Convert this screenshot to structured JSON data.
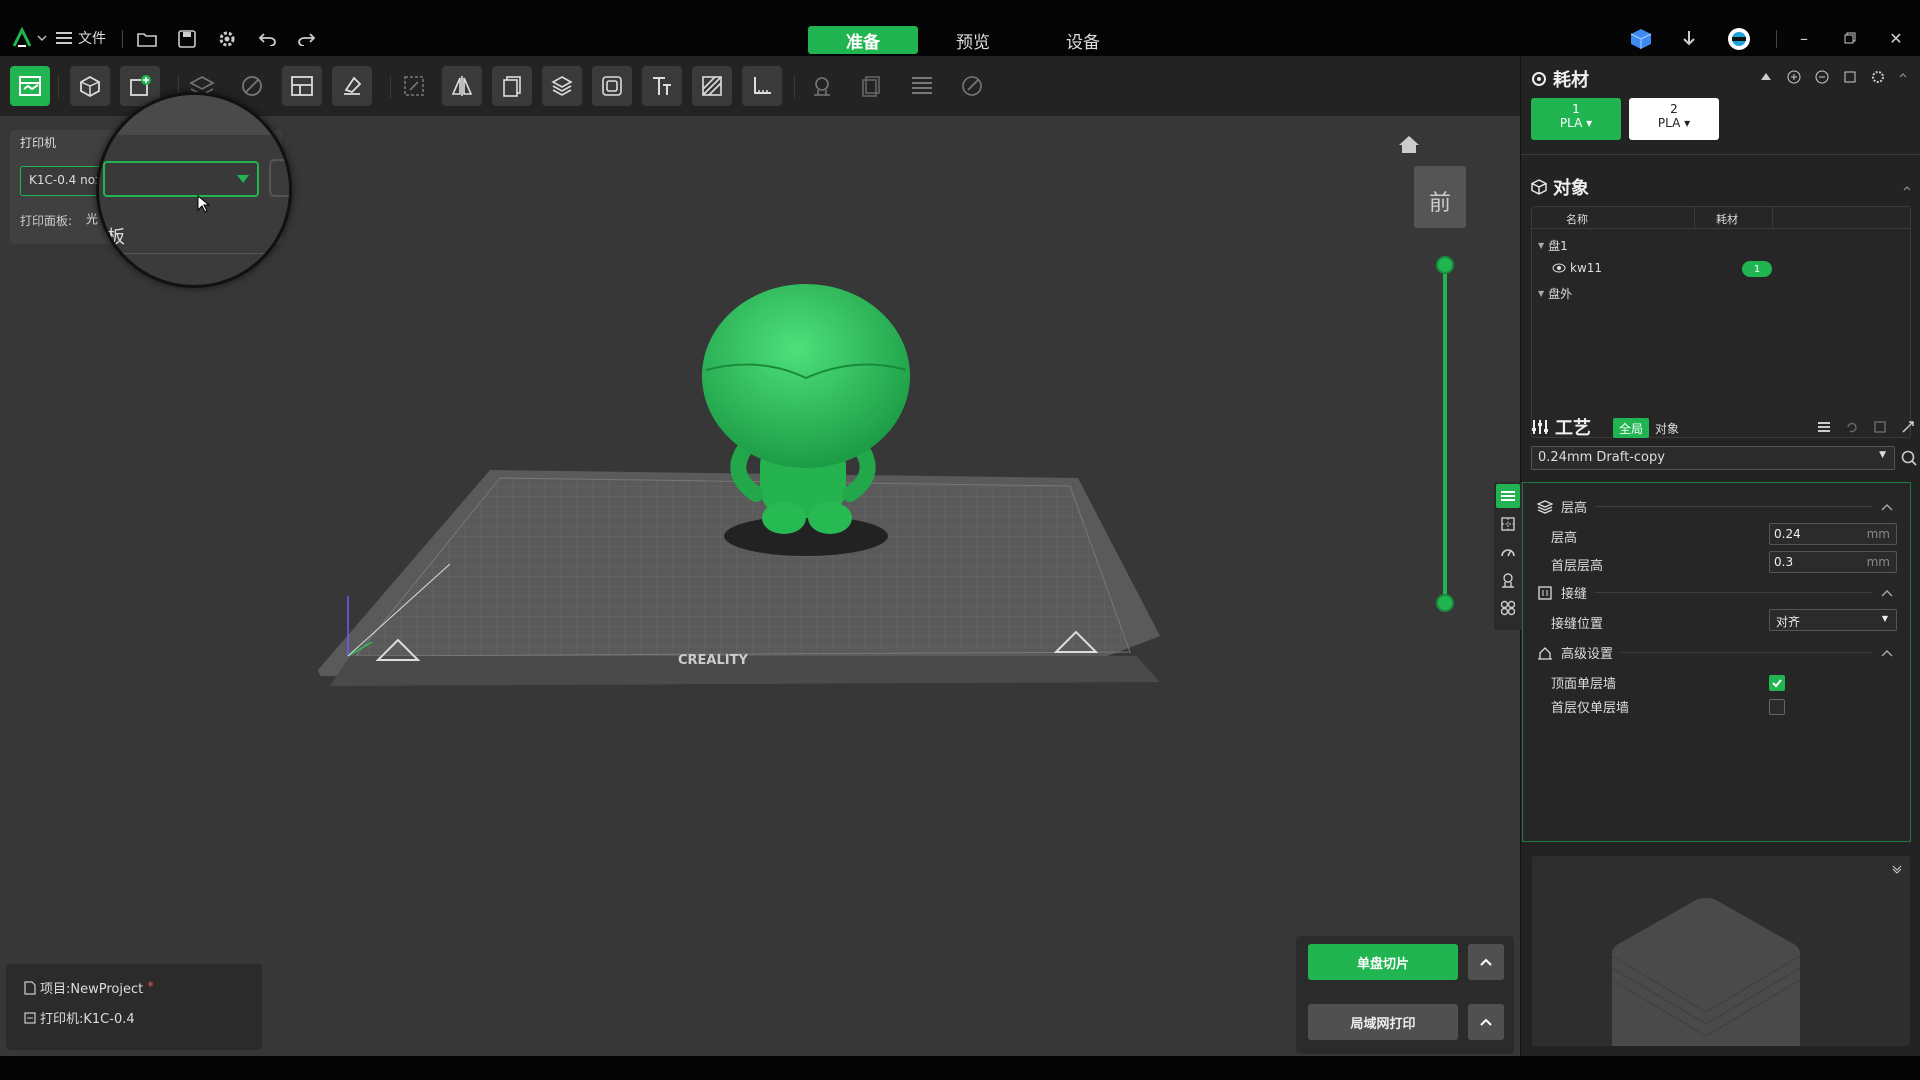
{
  "titlebar": {
    "file_menu": "文件",
    "tabs": [
      {
        "label": "准备",
        "active": true
      },
      {
        "label": "预览",
        "active": false
      },
      {
        "label": "设备",
        "active": false
      }
    ]
  },
  "printer_panel": {
    "title": "打印机",
    "printer_select": "K1C-0.4 noz",
    "plate_label": "打印面板:",
    "plate_value": "光",
    "magnified_text": "板"
  },
  "viewport": {
    "view_cube_label": "前",
    "plate_brand": "CREALITY"
  },
  "project": {
    "project_label": "项目:NewProject",
    "asterisk": "*",
    "printer_label": "打印机:K1C-0.4"
  },
  "slice": {
    "single_slice": "单盘切片",
    "lan_print": "局域网打印"
  },
  "materials": {
    "title": "耗材",
    "items": [
      {
        "num": "1",
        "type": "PLA"
      },
      {
        "num": "2",
        "type": "PLA"
      }
    ]
  },
  "objects": {
    "title": "对象",
    "col_name": "名称",
    "col_material": "耗材",
    "plate1": "盘1",
    "object_name": "kw11",
    "object_material": "1",
    "outside": "盘外"
  },
  "process": {
    "title": "工艺",
    "seg_global": "全局",
    "seg_object": "对象",
    "profile": "0.24mm Draft-copy",
    "groups": {
      "layer_height": "层高",
      "seam": "接缝",
      "advanced": "高级设置"
    },
    "params": {
      "layer_height_label": "层高",
      "layer_height_value": "0.24",
      "first_layer_label": "首层层高",
      "first_layer_value": "0.3",
      "unit": "mm",
      "seam_position_label": "接缝位置",
      "seam_position_value": "对齐",
      "top_single_wall_label": "顶面单层墙",
      "top_single_wall_checked": true,
      "first_single_wall_label": "首层仅单层墙",
      "first_single_wall_checked": false
    }
  },
  "colors": {
    "accent": "#20b550",
    "background": "#373737",
    "panel": "#232323"
  }
}
